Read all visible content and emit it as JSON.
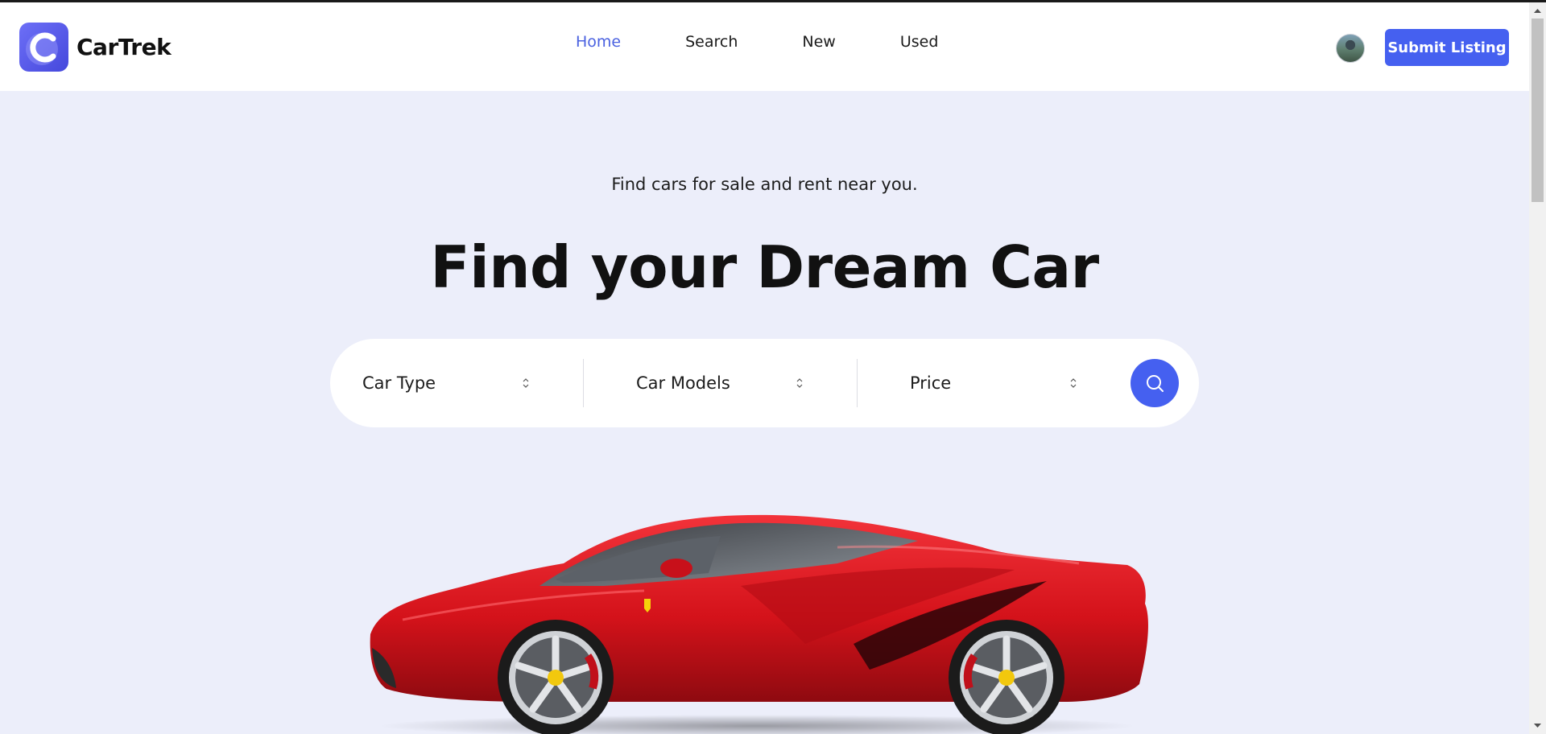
{
  "brand": {
    "name": "CarTrek",
    "logo_letter": "C",
    "logo_color": "#4f52e6"
  },
  "nav": {
    "items": [
      {
        "label": "Home",
        "active": true
      },
      {
        "label": "Search",
        "active": false
      },
      {
        "label": "New",
        "active": false
      },
      {
        "label": "Used",
        "active": false
      }
    ]
  },
  "header": {
    "avatar_icon": "user-avatar",
    "submit_label": "Submit Listing"
  },
  "hero": {
    "tagline": "Find cars for sale and rent near you.",
    "headline": "Find your Dream Car",
    "car_image": "red-sports-car"
  },
  "search": {
    "filters": [
      {
        "label": "Car Type",
        "icon": "chevron-up-down-icon"
      },
      {
        "label": "Car Models",
        "icon": "chevron-up-down-icon"
      },
      {
        "label": "Price",
        "icon": "chevron-up-down-icon"
      }
    ],
    "button_icon": "search-icon"
  },
  "colors": {
    "accent": "#4560f0",
    "active_nav": "#4a61e0",
    "background": "#eceefa",
    "car_body": "#d8141c"
  }
}
